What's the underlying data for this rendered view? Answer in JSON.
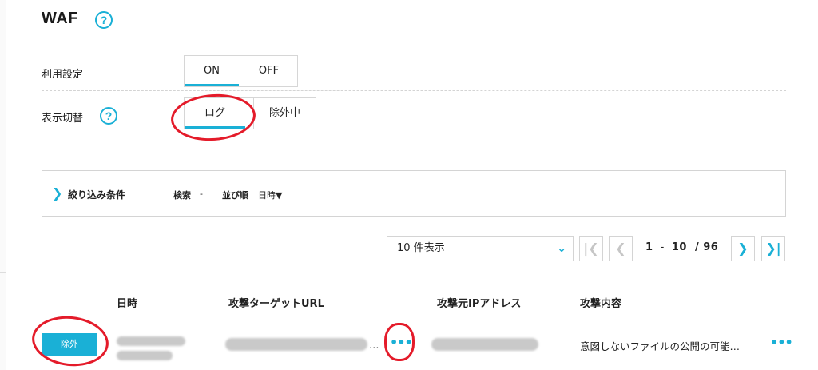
{
  "page": {
    "title": "WAF"
  },
  "settings": {
    "usage_label": "利用設定",
    "usage_on": "ON",
    "usage_off": "OFF",
    "display_label": "表示切替",
    "display_log": "ログ",
    "display_excluded": "除外中"
  },
  "filter": {
    "title": "絞り込み条件",
    "search_label": "検索",
    "search_value": "-",
    "sort_label": "並び順",
    "sort_value": "日時▼"
  },
  "pagination": {
    "per_page": "10 件表示",
    "range_start": "1",
    "range_sep": "-",
    "range_end": "10",
    "total": "/ 96"
  },
  "table": {
    "headers": [
      "日時",
      "攻撃ターゲットURL",
      "攻撃元IPアドレス",
      "攻撃内容"
    ],
    "rows": [
      {
        "action": "除外",
        "url_ellipsis": "…",
        "attack": "意図しないファイルの公開の可能…"
      }
    ]
  },
  "colors": {
    "accent": "#1ab0d6",
    "annotation": "#e41b2a"
  }
}
